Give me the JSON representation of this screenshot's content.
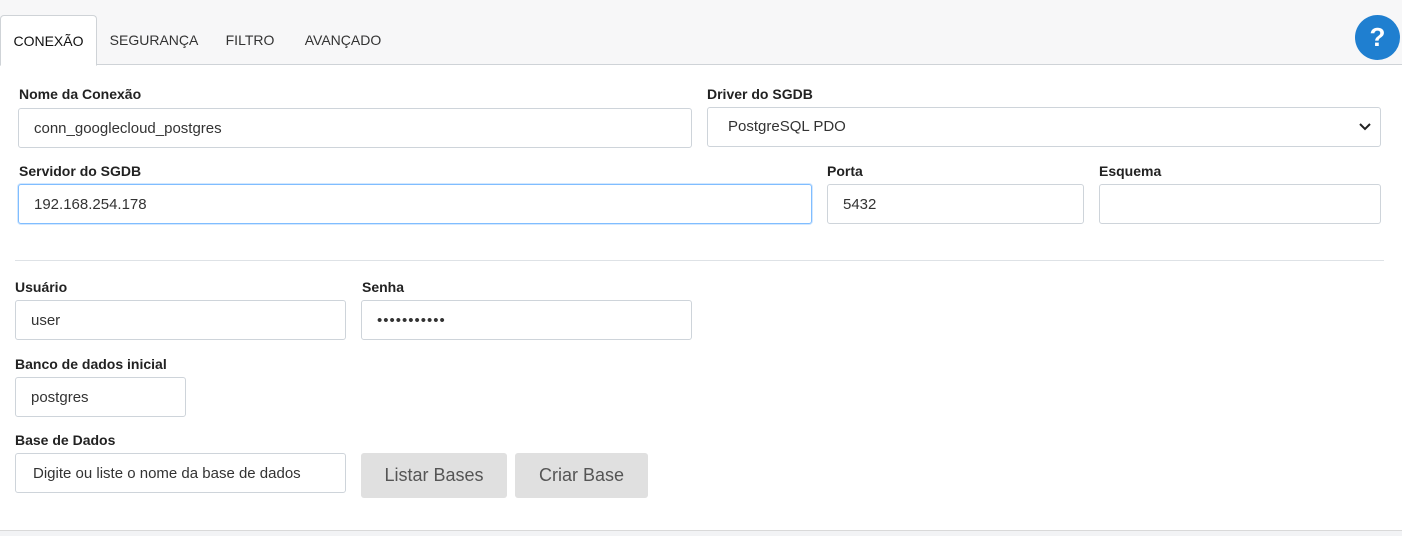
{
  "tabs": [
    {
      "label": "CONEXÃO",
      "active": true
    },
    {
      "label": "SEGURANÇA",
      "active": false
    },
    {
      "label": "FILTRO",
      "active": false
    },
    {
      "label": "AVANÇADO",
      "active": false
    }
  ],
  "help": {
    "label": "?"
  },
  "form": {
    "connection_name": {
      "label": "Nome da Conexão",
      "value": "conn_googlecloud_postgres"
    },
    "driver": {
      "label": "Driver do SGDB",
      "value": "PostgreSQL PDO"
    },
    "server": {
      "label": "Servidor do SGDB",
      "value": "192.168.254.178"
    },
    "port": {
      "label": "Porta",
      "value": "5432"
    },
    "schema": {
      "label": "Esquema",
      "value": ""
    },
    "user": {
      "label": "Usuário",
      "value": "user"
    },
    "password": {
      "label": "Senha",
      "value": "•••••••••••"
    },
    "initial_db": {
      "label": "Banco de dados inicial",
      "value": "postgres"
    },
    "database": {
      "label": "Base de Dados",
      "placeholder": "Digite ou liste o nome da base de dados"
    }
  },
  "buttons": {
    "list_bases": "Listar Bases",
    "create_base": "Criar Base"
  },
  "colors": {
    "accent": "#1f7fd0",
    "button_bg": "#e0e0e0"
  }
}
